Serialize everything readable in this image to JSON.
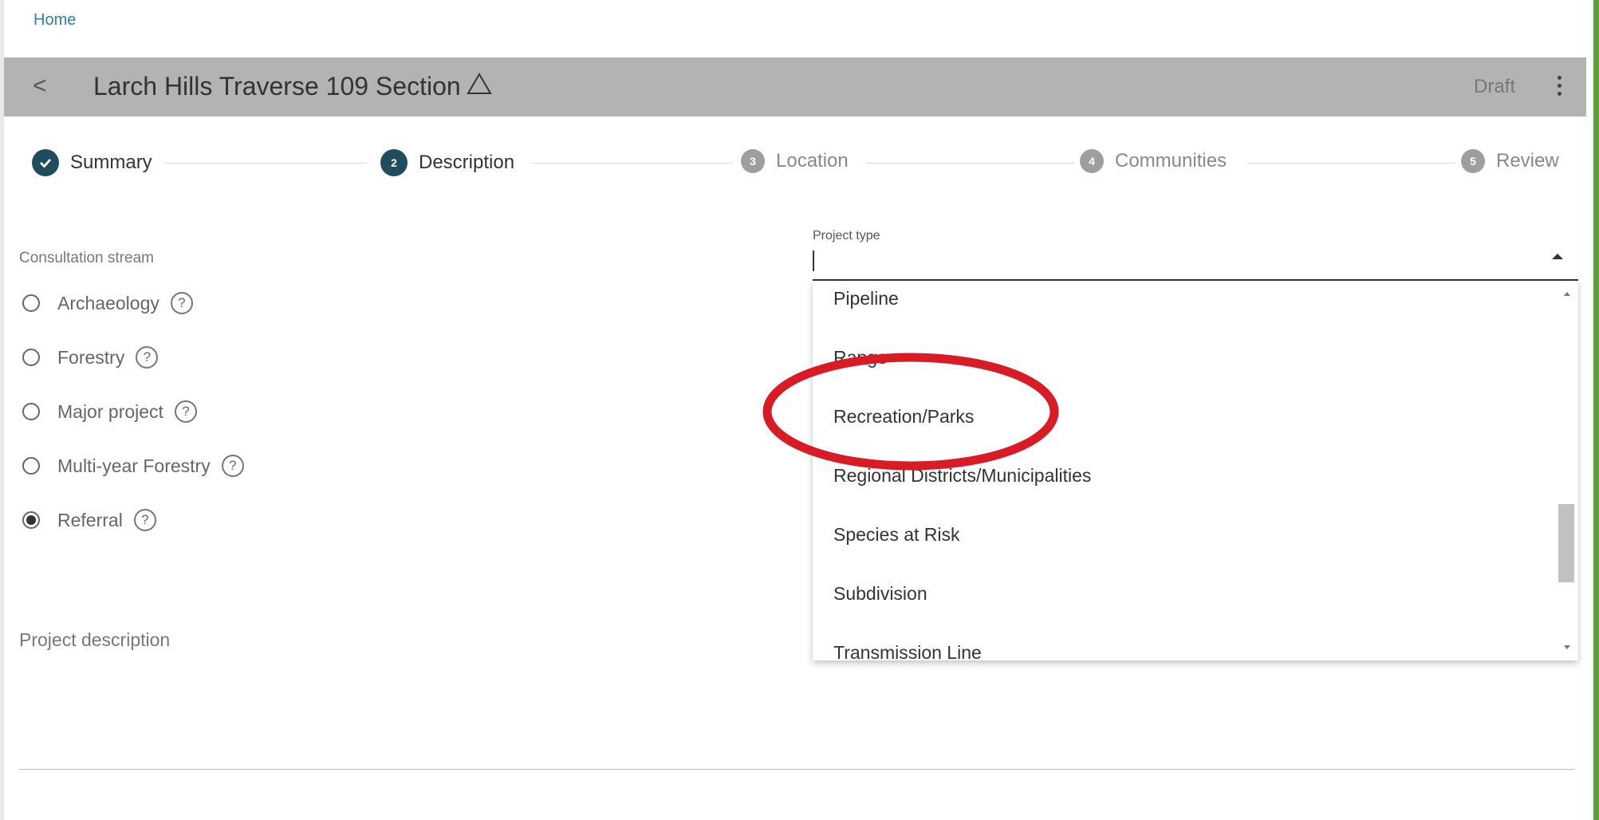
{
  "breadcrumb": {
    "home": "Home"
  },
  "appbar": {
    "back_glyph": "<",
    "title": "Larch Hills Traverse 109 Section",
    "warning_icon": "warning-triangle-icon",
    "status": "Draft",
    "menu_icon": "more-vert-icon"
  },
  "stepper": {
    "steps": [
      {
        "number": "",
        "label": "Summary",
        "state": "done"
      },
      {
        "number": "2",
        "label": "Description",
        "state": "active"
      },
      {
        "number": "3",
        "label": "Location",
        "state": "todo"
      },
      {
        "number": "4",
        "label": "Communities",
        "state": "todo"
      },
      {
        "number": "5",
        "label": "Review",
        "state": "todo"
      }
    ]
  },
  "consultation": {
    "label": "Consultation stream",
    "options": [
      {
        "label": "Archaeology",
        "selected": false
      },
      {
        "label": "Forestry",
        "selected": false
      },
      {
        "label": "Major project",
        "selected": false
      },
      {
        "label": "Multi-year Forestry",
        "selected": false
      },
      {
        "label": "Referral",
        "selected": true
      }
    ],
    "help_glyph": "?"
  },
  "description": {
    "label": "Project description"
  },
  "project_type": {
    "label": "Project type",
    "value": "",
    "options": [
      "Pipeline",
      "Range",
      "Recreation/Parks",
      "Regional Districts/Municipalities",
      "Species at Risk",
      "Subdivision",
      "Transmission Line"
    ]
  },
  "colors": {
    "accent": "#1f4d5e",
    "appbar": "#b3b3b3",
    "link": "#2f7fb5",
    "annotation": "#d81b24"
  }
}
